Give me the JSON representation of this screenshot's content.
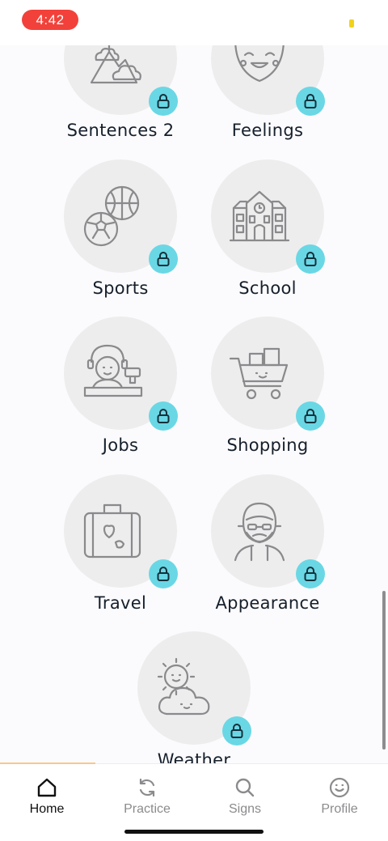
{
  "status_bar": {
    "time": "4:42"
  },
  "categories": [
    {
      "label": "Sentences 2",
      "icon": "mountain-clouds-icon",
      "locked": true
    },
    {
      "label": "Feelings",
      "icon": "laughing-face-icon",
      "locked": true
    },
    {
      "label": "Sports",
      "icon": "sports-balls-icon",
      "locked": true
    },
    {
      "label": "School",
      "icon": "school-building-icon",
      "locked": true
    },
    {
      "label": "Jobs",
      "icon": "cashier-worker-icon",
      "locked": true
    },
    {
      "label": "Shopping",
      "icon": "shopping-cart-icon",
      "locked": true
    },
    {
      "label": "Travel",
      "icon": "suitcase-icon",
      "locked": true
    },
    {
      "label": "Appearance",
      "icon": "bearded-man-icon",
      "locked": true
    },
    {
      "label": "Weather",
      "icon": "sun-cloud-icon",
      "locked": true
    }
  ],
  "tabbar": {
    "active": "Home",
    "tabs": [
      {
        "label": "Home",
        "icon": "home-icon"
      },
      {
        "label": "Practice",
        "icon": "refresh-icon"
      },
      {
        "label": "Signs",
        "icon": "search-icon"
      },
      {
        "label": "Profile",
        "icon": "smiley-icon"
      }
    ]
  },
  "colors": {
    "lock_badge": "#6ad7e5",
    "circle": "#ededee",
    "time_pill": "#f2413a",
    "accent": "#f7c98a"
  }
}
